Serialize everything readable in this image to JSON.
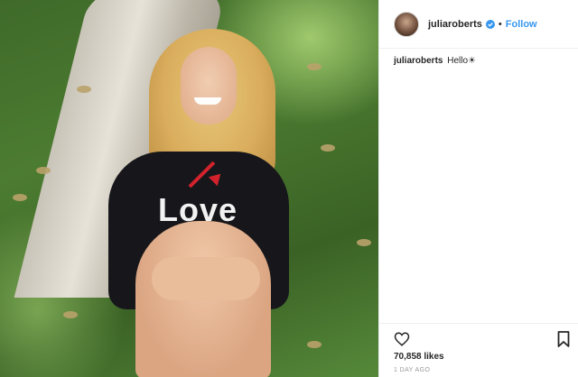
{
  "post": {
    "username": "juliaroberts",
    "follow_label": "Follow",
    "separator": "•",
    "caption_user": "juliaroberts",
    "caption_text": "Hello☀",
    "likes": "70,858 likes",
    "time": "1 DAY AGO"
  },
  "photo": {
    "sweater_text": "Love"
  },
  "colors": {
    "follow": "#3897f0",
    "verified": "#3897f0",
    "arrow": "#d4222c"
  },
  "icons": [
    "verified-badge-icon",
    "heart-icon",
    "bookmark-icon"
  ]
}
